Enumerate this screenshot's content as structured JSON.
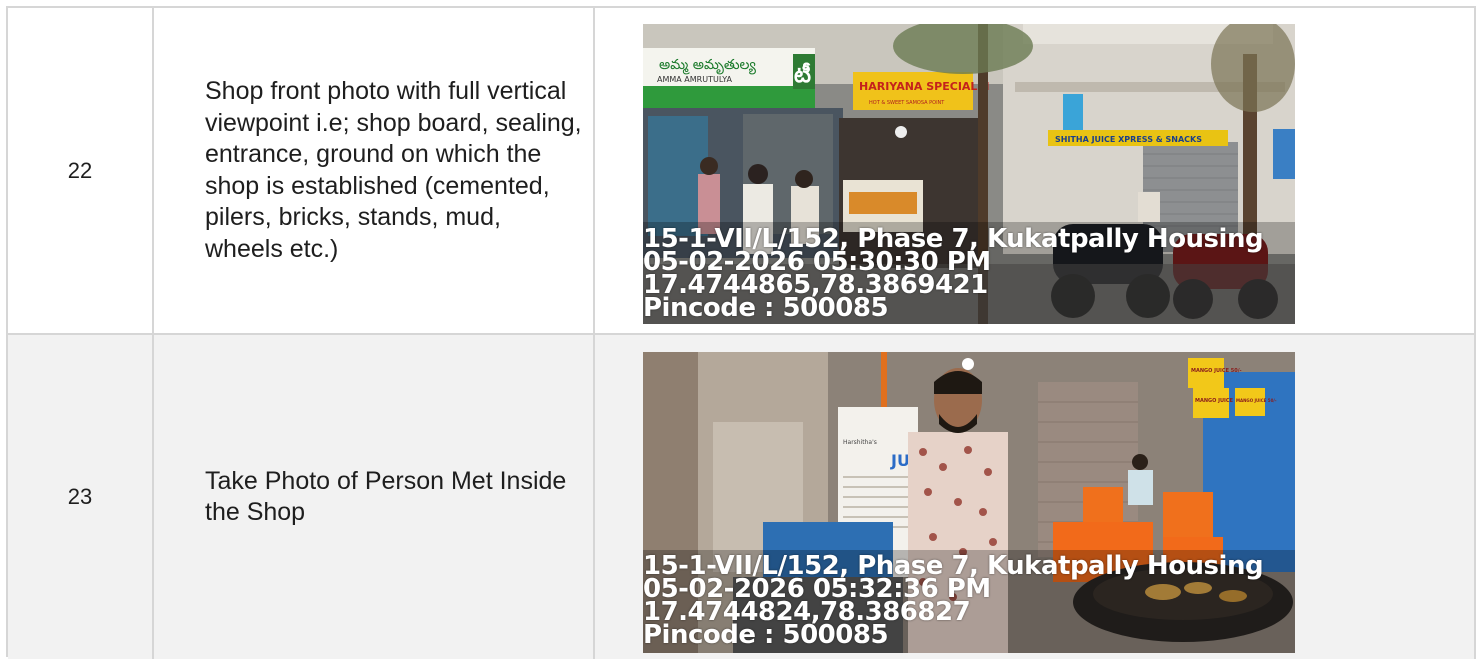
{
  "rows": [
    {
      "number": "22",
      "description": "Shop front photo with full vertical viewpoint i.e; shop board, sealing, entrance, ground on which the shop is established (cemented, pilers, bricks, stands, mud, wheels etc.)",
      "photo": {
        "address": "15-1-VII/L/152, Phase 7, Kukatpally Housing",
        "datetime": "05-02-2026 05:30:30 PM",
        "coords": "17.4744865,78.3869421",
        "pincode": "Pincode : 500085",
        "signs": {
          "store_telugu": "అమ్మ అమృతుల్య",
          "store": "AMMA AMRUTULYA",
          "tea_glyph": "టీ",
          "stall": "HARIYANA SPECIAL JI",
          "stall_small": "HOT & SWEET SAMOSA POINT",
          "juice": "SHITHA JUICE XPRESS & SNACKS"
        }
      }
    },
    {
      "number": "23",
      "description": "Take Photo of Person Met Inside the Shop",
      "photo": {
        "address": "15-1-VII/L/152, Phase 7, Kukatpally Housing",
        "datetime": "05-02-2026 05:32:36 PM",
        "coords": "17.4744824,78.386827",
        "pincode": "Pincode : 500085",
        "signs": {
          "mango1": "MANGO JUICE 50/-",
          "mango2": "MANGO JUICE 50/-",
          "mango3": "MANGO JUICE 50/-",
          "menu_title": "JUIC",
          "menu_brand": "Harshitha's"
        }
      }
    }
  ]
}
